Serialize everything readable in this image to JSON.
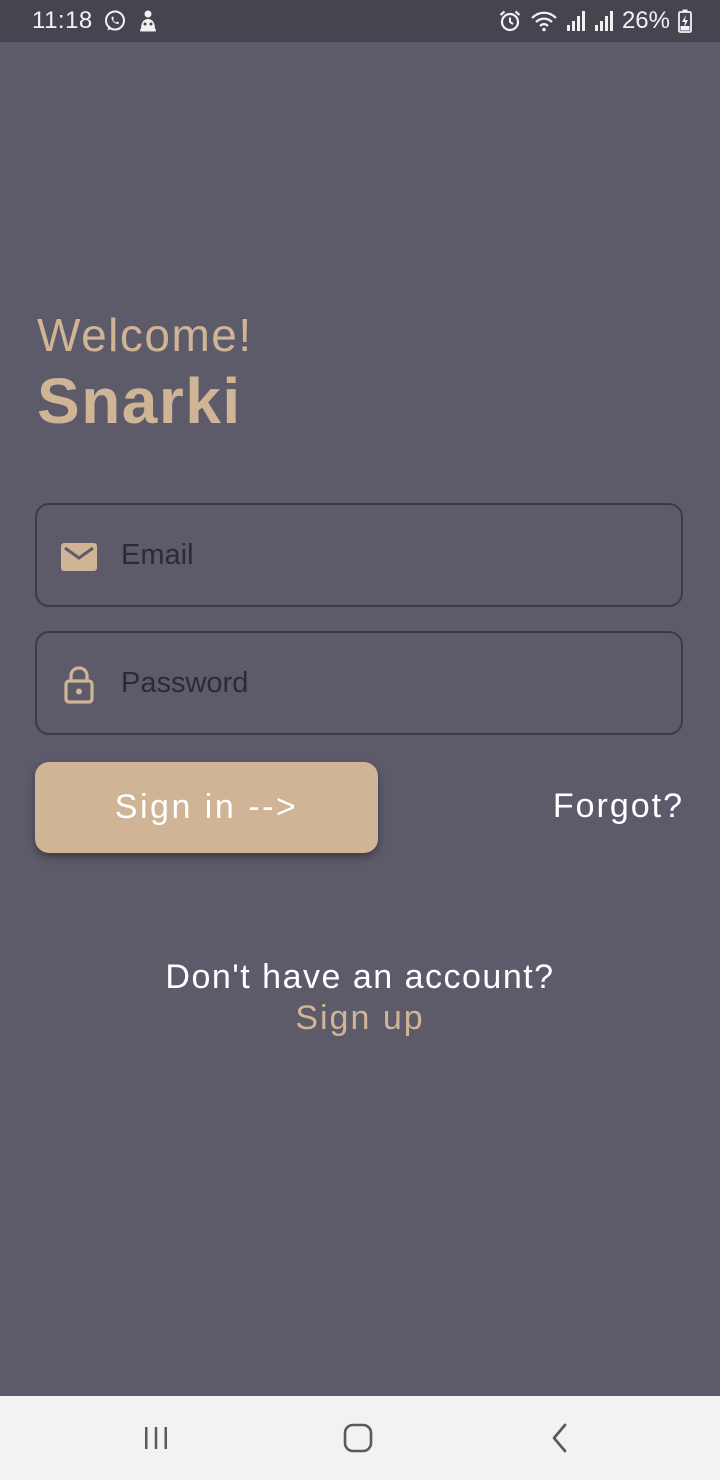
{
  "status_bar": {
    "time": "11:18",
    "battery": "26%",
    "left_icons": [
      "whatsapp-icon",
      "notification-app-icon"
    ],
    "right_icons": [
      "alarm-icon",
      "wifi-icon",
      "signal-icon",
      "signal-icon",
      "battery-charging-icon"
    ]
  },
  "header": {
    "welcome": "Welcome!",
    "app_name": "Snarki"
  },
  "form": {
    "email": {
      "placeholder": "Email",
      "value": "",
      "icon": "mail-icon"
    },
    "password": {
      "placeholder": "Password",
      "value": "",
      "icon": "lock-icon"
    },
    "signin_label": "Sign in -->",
    "forgot_label": "Forgot?"
  },
  "footer": {
    "no_account": "Don't have an account?",
    "signup_label": "Sign up"
  },
  "nav_bar": {
    "buttons": [
      "recents-icon",
      "home-icon",
      "back-icon"
    ]
  },
  "colors": {
    "background": "#5d5b6a",
    "status_bar": "#46444f",
    "accent": "#cfb495",
    "field_border": "#3c3a47",
    "text_light": "#ffffff",
    "nav_bar": "#f2f2f2"
  }
}
